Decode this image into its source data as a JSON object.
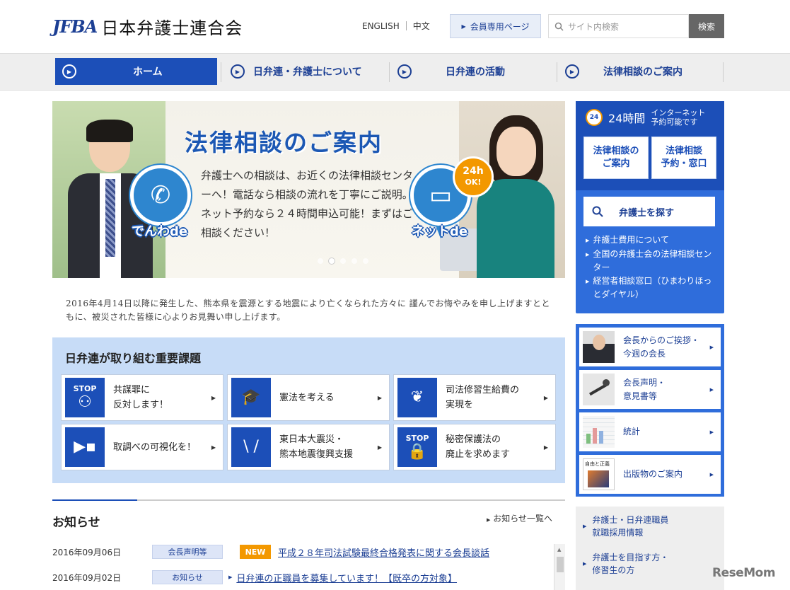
{
  "header": {
    "logo_mark": "JFBA",
    "logo_text": "日本弁護士連合会",
    "lang_english": "ENGLISH",
    "lang_chinese": "中文",
    "member_label": "会員専用ページ",
    "search_placeholder": "サイト内検索",
    "search_button": "検索"
  },
  "nav": {
    "items": [
      {
        "label": "ホーム",
        "active": true
      },
      {
        "label": "日弁連・弁護士について"
      },
      {
        "label": "日弁連の活動"
      },
      {
        "label": "法律相談のご案内"
      }
    ]
  },
  "hero": {
    "title": "法律相談のご案内",
    "body": "弁護士への相談は、お近くの法律相談センターへ！電話なら相談の流れを丁寧にご説明。ネット予約なら２４時間申込可能！まずはご相談ください！",
    "phone_label": "でんわde",
    "net_label": "ネットde",
    "badge_top": "24h",
    "badge_bottom": "OK!"
  },
  "condolence": "2016年4月14日以降に発生した、熊本県を震源とする地震により亡くなられた方々に 謹んでお悔やみを申し上げますとともに、被災された皆様に心よりお見舞い申し上げます。",
  "issues": {
    "title": "日弁連が取り組む重要課題",
    "stop_label": "STOP",
    "items": [
      {
        "line1": "共謀罪に",
        "line2": "反対します！",
        "icon": "stop-people-icon"
      },
      {
        "line1": "憲法を考える",
        "line2": "",
        "icon": "graduation-cap-icon"
      },
      {
        "line1": "司法修習生給費の",
        "line2": "実現を",
        "icon": "sprout-icon"
      },
      {
        "line1": "取調べの可視化を！",
        "line2": "",
        "icon": "video-camera-icon"
      },
      {
        "line1": "東日本大震災・",
        "line2": "熊本地震復興支援",
        "icon": "hands-icon"
      },
      {
        "line1": "秘密保護法の",
        "line2": "廃止を求めます",
        "icon": "stop-lock-icon"
      }
    ]
  },
  "news": {
    "title": "お知らせ",
    "more": "お知らせ一覧へ",
    "new_label": "NEW",
    "items": [
      {
        "date": "2016年09月06日",
        "category": "会長声明等",
        "new": true,
        "text": "平成２８年司法試験最終合格発表に関する会長談話"
      },
      {
        "date": "2016年09月02日",
        "category": "お知らせ",
        "new": false,
        "text": "日弁連の正職員を募集しています！【既卒の方対象】"
      }
    ]
  },
  "sidebar": {
    "clock_label": "24",
    "hours_label": "24時間",
    "net_line1": "インターネット",
    "net_line2": "予約可能です",
    "btn1_line1": "法律相談の",
    "btn1_line2": "ご案内",
    "btn2_line1": "法律相談",
    "btn2_line2": "予約・窓口",
    "find_label": "弁護士を探す",
    "links": [
      "弁護士費用について",
      "全国の弁護士会の法律相談センター",
      "経営者相談窓口（ひまわりほっとダイヤル）"
    ],
    "thumbs": [
      {
        "line1": "会長からのご挨拶・",
        "line2": "今週の会長"
      },
      {
        "line1": "会長声明・",
        "line2": "意見書等"
      },
      {
        "line1": "統計",
        "line2": ""
      },
      {
        "line1": "出版物のご案内",
        "line2": ""
      }
    ],
    "thumb_book_text": "自由と正義",
    "recruit": [
      {
        "line1": "弁護士・日弁連職員",
        "line2": "就職採用情報"
      },
      {
        "line1": "弁護士を目指す方・",
        "line2": "修習生の方"
      }
    ]
  },
  "watermark": "ReseMom"
}
